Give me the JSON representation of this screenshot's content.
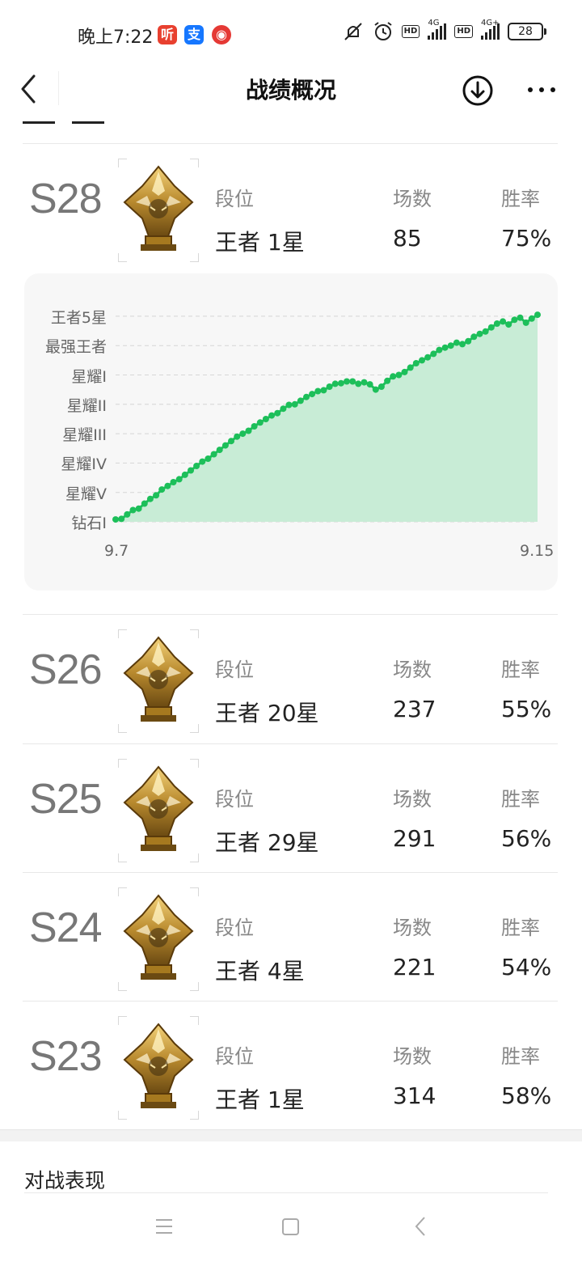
{
  "status_bar": {
    "time": "晚上7:22",
    "apps": [
      {
        "icon": "ting-app-icon",
        "glyph": "听",
        "color": "#e8402f"
      },
      {
        "icon": "alipay-app-icon",
        "glyph": "支",
        "color": "#1677ff"
      },
      {
        "icon": "netease-music-app-icon",
        "glyph": "◉",
        "color": "#e53935"
      }
    ],
    "net1": "4G",
    "net2": "4G+",
    "hd": "HD",
    "battery": "28"
  },
  "nav": {
    "title": "战绩概况",
    "back_icon": "chevron-left-icon",
    "download_icon": "download-circle-icon",
    "more_icon": "more-dots-icon"
  },
  "seasons": [
    {
      "code": "S28",
      "tier_label": "段位",
      "tier": "王者 1星",
      "games_label": "场数",
      "games": "85",
      "rate_label": "胜率",
      "rate": "75%"
    },
    {
      "code": "S26",
      "tier_label": "段位",
      "tier": "王者 20星",
      "games_label": "场数",
      "games": "237",
      "rate_label": "胜率",
      "rate": "55%"
    },
    {
      "code": "S25",
      "tier_label": "段位",
      "tier": "王者 29星",
      "games_label": "场数",
      "games": "291",
      "rate_label": "胜率",
      "rate": "56%"
    },
    {
      "code": "S24",
      "tier_label": "段位",
      "tier": "王者 4星",
      "games_label": "场数",
      "games": "221",
      "rate_label": "胜率",
      "rate": "54%"
    },
    {
      "code": "S23",
      "tier_label": "段位",
      "tier": "王者 1星",
      "games_label": "场数",
      "games": "314",
      "rate_label": "胜率",
      "rate": "58%"
    }
  ],
  "chart_data": {
    "type": "area",
    "x_start": "9.7",
    "x_end": "9.15",
    "y_categories": [
      "钻石I",
      "星耀V",
      "星耀IV",
      "星耀III",
      "星耀II",
      "星耀I",
      "最强王者",
      "王者5星"
    ],
    "values": [
      0.08,
      0.1,
      0.25,
      0.4,
      0.45,
      0.62,
      0.78,
      0.9,
      1.1,
      1.22,
      1.35,
      1.45,
      1.6,
      1.75,
      1.9,
      2.05,
      2.15,
      2.3,
      2.45,
      2.6,
      2.75,
      2.9,
      3.0,
      3.1,
      3.25,
      3.38,
      3.5,
      3.62,
      3.7,
      3.85,
      3.98,
      4.0,
      4.12,
      4.25,
      4.35,
      4.45,
      4.48,
      4.6,
      4.7,
      4.72,
      4.78,
      4.78,
      4.7,
      4.75,
      4.68,
      4.5,
      4.6,
      4.8,
      4.95,
      5.0,
      5.1,
      5.25,
      5.4,
      5.5,
      5.6,
      5.72,
      5.85,
      5.93,
      6.0,
      6.1,
      6.05,
      6.15,
      6.3,
      6.4,
      6.48,
      6.62,
      6.75,
      6.82,
      6.72,
      6.88,
      6.95,
      6.78,
      6.92,
      7.05
    ],
    "ylim": [
      0,
      7
    ],
    "grid": true,
    "line_color": "#1dbf5a",
    "fill_color": "#c8ecd6"
  },
  "bottom": {
    "section_title": "对战表现",
    "nav_icons": [
      "menu-icon",
      "home-square-icon",
      "back-triangle-icon"
    ]
  }
}
